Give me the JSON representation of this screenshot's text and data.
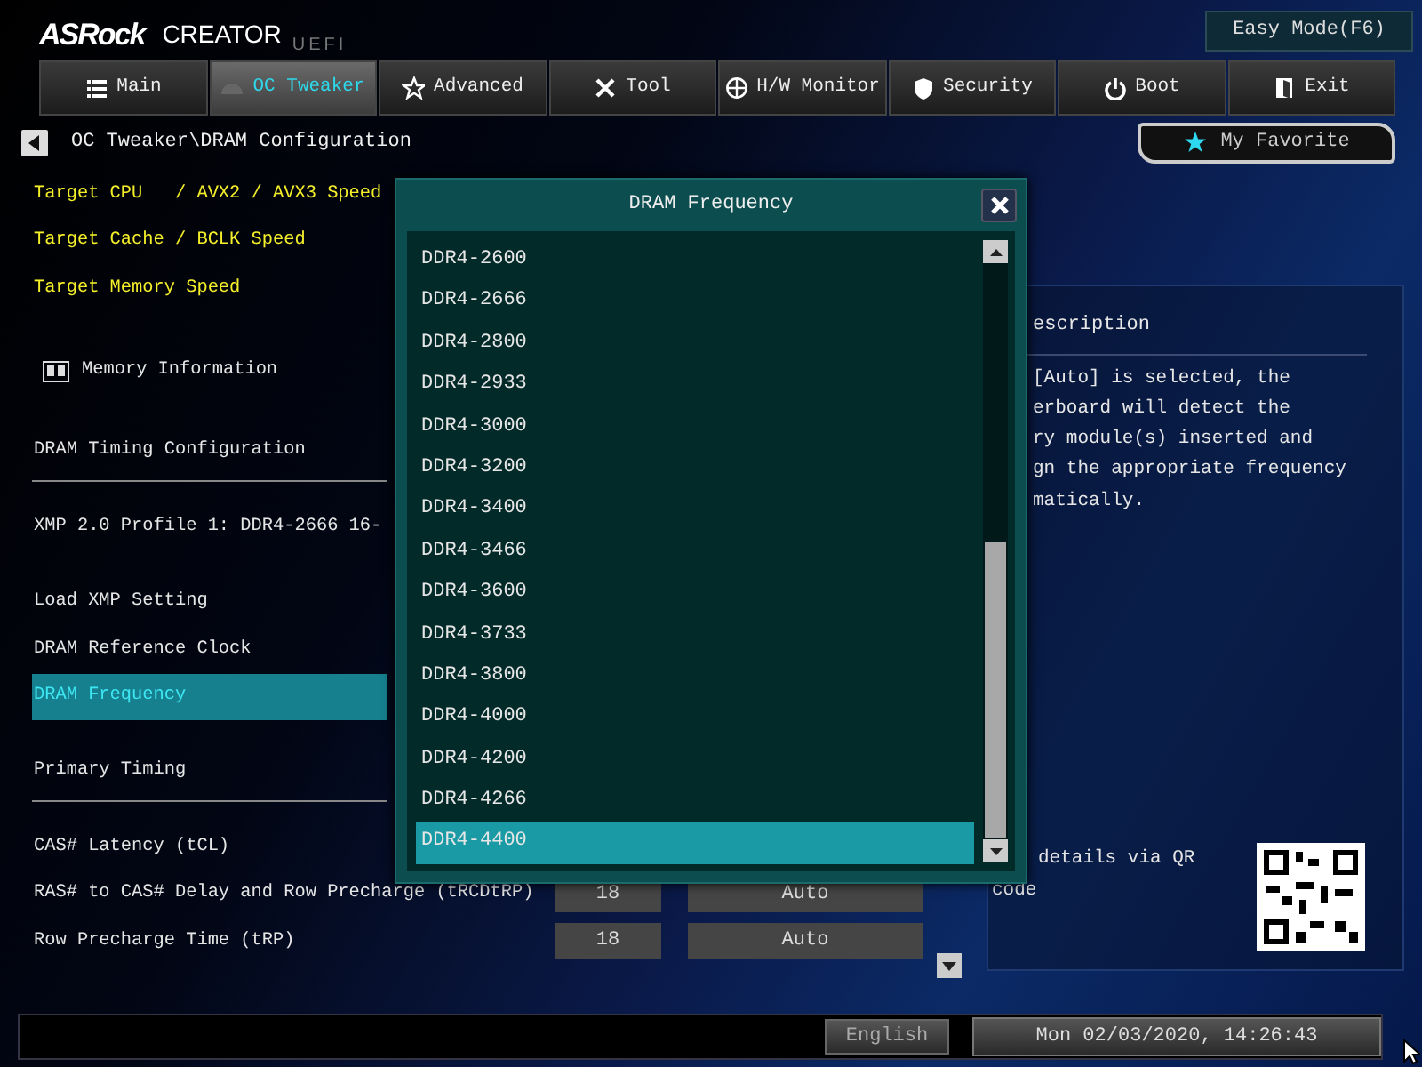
{
  "header": {
    "brand": "ASRock",
    "product": "CREATOR",
    "edition": "UEFI",
    "easy_mode": "Easy Mode(F6)"
  },
  "tabs": [
    {
      "label": "Main",
      "selected": false
    },
    {
      "label": "OC Tweaker",
      "selected": true
    },
    {
      "label": "Advanced",
      "selected": false
    },
    {
      "label": "Tool",
      "selected": false
    },
    {
      "label": "H/W Monitor",
      "selected": false
    },
    {
      "label": "Security",
      "selected": false
    },
    {
      "label": "Boot",
      "selected": false
    },
    {
      "label": "Exit",
      "selected": false
    }
  ],
  "breadcrumb": "OC Tweaker\\DRAM Configuration",
  "favorite": "My Favorite",
  "settings": [
    {
      "kind": "target",
      "label": "Target CPU   / AVX2 / AVX3 Speed",
      "selected": false
    },
    {
      "kind": "target",
      "label": "Target Cache / BCLK Speed",
      "selected": false
    },
    {
      "kind": "target",
      "label": "Target Memory Speed",
      "selected": false
    },
    {
      "kind": "info",
      "label": "Memory Information",
      "selected": false
    },
    {
      "kind": "header",
      "label": "DRAM Timing Configuration",
      "selected": false
    },
    {
      "kind": "profile",
      "label": "XMP 2.0 Profile 1: DDR4-2666 16-",
      "selected": false
    },
    {
      "kind": "item",
      "label": "Load XMP Setting",
      "selected": false
    },
    {
      "kind": "item",
      "label": "DRAM Reference Clock",
      "selected": false
    },
    {
      "kind": "item",
      "label": "DRAM Frequency",
      "selected": true
    },
    {
      "kind": "header",
      "label": "Primary Timing",
      "selected": false
    },
    {
      "kind": "item",
      "label": "CAS# Latency (tCL)",
      "selected": false
    },
    {
      "kind": "item",
      "label": "RAS# to CAS# Delay and Row Precharge (tRCDtRP)",
      "selected": false,
      "values": [
        "18",
        "Auto"
      ]
    },
    {
      "kind": "item",
      "label": "Row Precharge Time (tRP)",
      "selected": false,
      "values": [
        "18",
        "Auto"
      ]
    }
  ],
  "description": {
    "title": "escription",
    "lines": [
      "[Auto] is selected, the",
      "erboard will detect the",
      "ry module(s) inserted and",
      "gn the appropriate frequency",
      "matically."
    ],
    "qr_lines": [
      "details via QR",
      "code"
    ]
  },
  "dialog": {
    "title": "DRAM Frequency",
    "options": [
      {
        "label": "DDR4-2600",
        "selected": false
      },
      {
        "label": "DDR4-2666",
        "selected": false
      },
      {
        "label": "DDR4-2800",
        "selected": false
      },
      {
        "label": "DDR4-2933",
        "selected": false
      },
      {
        "label": "DDR4-3000",
        "selected": false
      },
      {
        "label": "DDR4-3200",
        "selected": false
      },
      {
        "label": "DDR4-3400",
        "selected": false
      },
      {
        "label": "DDR4-3466",
        "selected": false
      },
      {
        "label": "DDR4-3600",
        "selected": false
      },
      {
        "label": "DDR4-3733",
        "selected": false
      },
      {
        "label": "DDR4-3800",
        "selected": false
      },
      {
        "label": "DDR4-4000",
        "selected": false
      },
      {
        "label": "DDR4-4200",
        "selected": false
      },
      {
        "label": "DDR4-4266",
        "selected": false
      },
      {
        "label": "DDR4-4400",
        "selected": true
      }
    ]
  },
  "status_bar": {
    "language": "English",
    "datetime": "Mon 02/03/2020, 14:26:43"
  }
}
